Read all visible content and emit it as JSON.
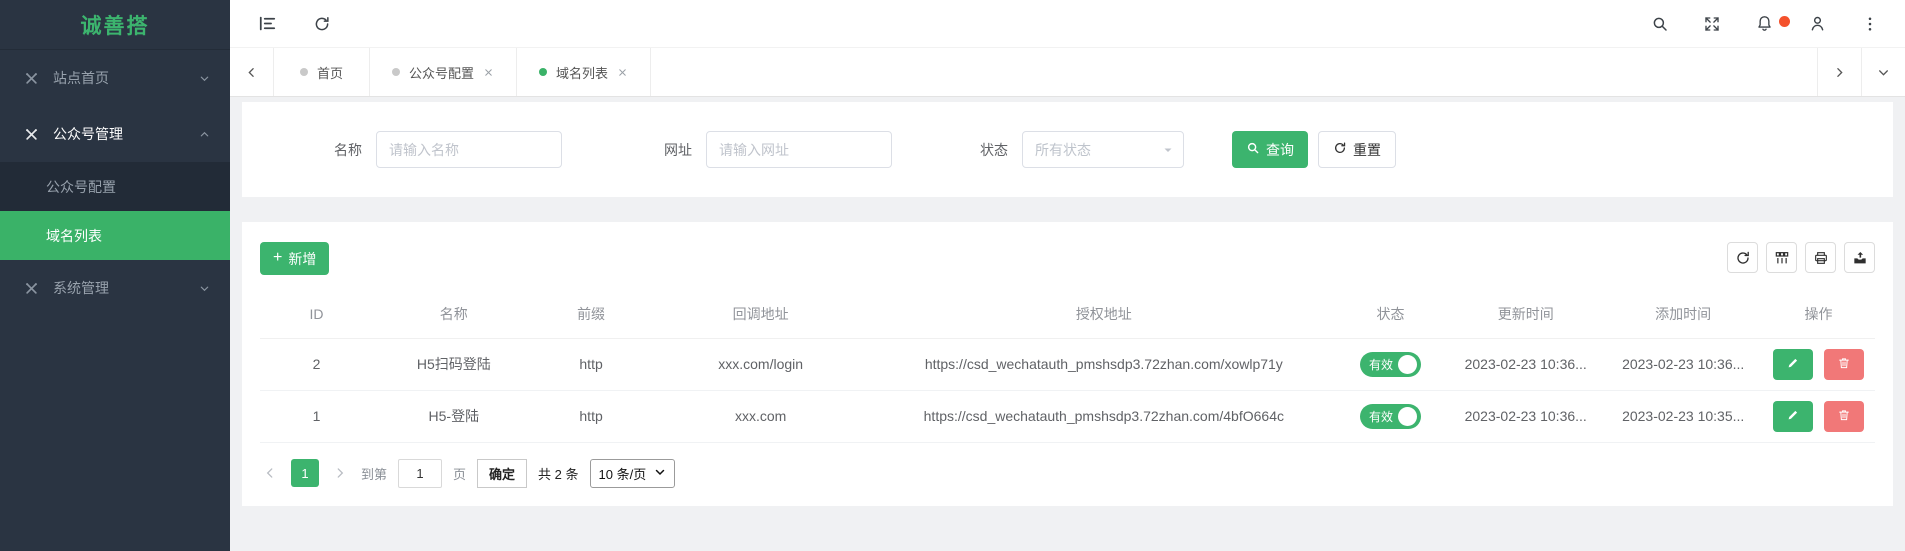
{
  "colors": {
    "accent_green": "#3cb46e",
    "sidebar_bg": "#2a3442",
    "submenu_bg": "#222b37",
    "active_menu_green": "#3ab268",
    "danger_red": "#f17878",
    "notification_badge": "#f4512c"
  },
  "sidebar": {
    "logo": "诚善搭",
    "items": [
      {
        "label": "站点首页",
        "state": "collapsed"
      },
      {
        "label": "公众号管理",
        "state": "expanded",
        "children": [
          {
            "label": "公众号配置",
            "active": false
          },
          {
            "label": "域名列表",
            "active": true
          }
        ]
      },
      {
        "label": "系统管理",
        "state": "collapsed"
      }
    ]
  },
  "tabs": [
    {
      "label": "首页",
      "closable": false,
      "active": false
    },
    {
      "label": "公众号配置",
      "closable": true,
      "active": false
    },
    {
      "label": "域名列表",
      "closable": true,
      "active": true
    }
  ],
  "filters": {
    "name_label": "名称",
    "name_placeholder": "请输入名称",
    "url_label": "网址",
    "url_placeholder": "请输入网址",
    "status_label": "状态",
    "status_value": "所有状态",
    "search_button": "查询",
    "reset_button": "重置"
  },
  "toolbar": {
    "add_button": "新增"
  },
  "table": {
    "columns": [
      "ID",
      "名称",
      "前缀",
      "回调地址",
      "授权地址",
      "状态",
      "更新时间",
      "添加时间",
      "操作"
    ],
    "rows": [
      {
        "id": "2",
        "name": "H5扫码登陆",
        "prefix": "http",
        "callback": "xxx.com/login",
        "auth_url": "https://csd_wechatauth_pmshsdp3.72zhan.com/xowlp71y",
        "status": "有效",
        "updated": "2023-02-23 10:36...",
        "created": "2023-02-23 10:36..."
      },
      {
        "id": "1",
        "name": "H5-登陆",
        "prefix": "http",
        "callback": "xxx.com",
        "auth_url": "https://csd_wechatauth_pmshsdp3.72zhan.com/4bfO664c",
        "status": "有效",
        "updated": "2023-02-23 10:36...",
        "created": "2023-02-23 10:35..."
      }
    ]
  },
  "pagination": {
    "current_page": "1",
    "goto_label": "到第",
    "goto_value": "1",
    "page_label": "页",
    "confirm_button": "确定",
    "total_text": "共 2 条",
    "page_size": "10 条/页"
  }
}
